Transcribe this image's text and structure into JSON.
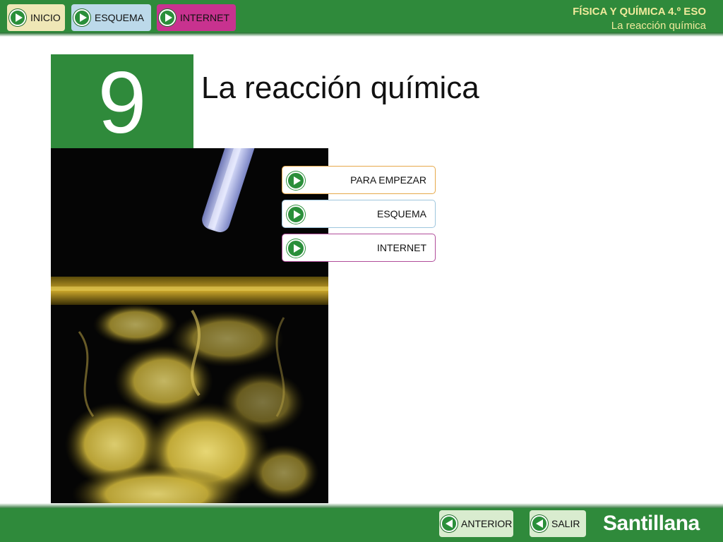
{
  "header": {
    "nav": [
      {
        "label": "INICIO"
      },
      {
        "label": "ESQUEMA"
      },
      {
        "label": "INTERNET"
      }
    ],
    "course_title": "FÍSICA Y QUÍMICA 4.º ESO",
    "unit_subtitle": "La reacción química"
  },
  "chapter": {
    "number": "9",
    "title": "La reacción química"
  },
  "menu": [
    {
      "label": "PARA EMPEZAR"
    },
    {
      "label": "ESQUEMA"
    },
    {
      "label": "INTERNET"
    }
  ],
  "footer": {
    "back_label": "ANTERIOR",
    "exit_label": "SALIR",
    "brand": "Santillana"
  },
  "colors": {
    "brand_green": "#2f8a3b",
    "header_text": "#f0ea9c",
    "inicio_bg": "#efe7b6",
    "esquema_bg": "#bcd9ea",
    "internet_bg": "#c8328f"
  },
  "icons": [
    "play-icon",
    "back-arrow-icon"
  ]
}
